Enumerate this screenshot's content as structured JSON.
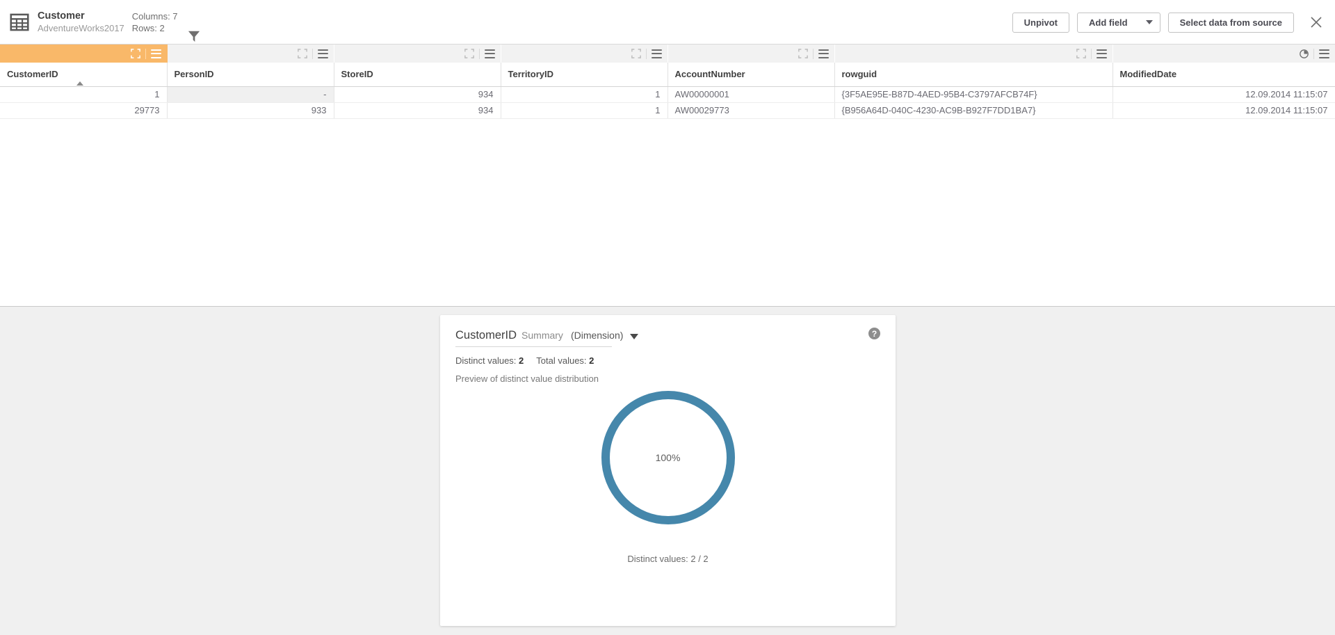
{
  "header": {
    "table_icon": "table-icon",
    "table_name": "Customer",
    "source_name": "AdventureWorks2017",
    "columns_label": "Columns: 7",
    "rows_label": "Rows: 2",
    "filter_icon": "filter-icon",
    "buttons": {
      "unpivot": "Unpivot",
      "add_field": "Add field",
      "select_data": "Select data from source",
      "close_icon": "close-icon"
    }
  },
  "table": {
    "columns": [
      {
        "name": "CustomerID",
        "align": "num",
        "selected": true,
        "sorted": "asc",
        "tool_icon": "expand-icon"
      },
      {
        "name": "PersonID",
        "align": "num",
        "selected": false,
        "sorted": null,
        "tool_icon": "expand-icon"
      },
      {
        "name": "StoreID",
        "align": "num",
        "selected": false,
        "sorted": null,
        "tool_icon": "expand-icon"
      },
      {
        "name": "TerritoryID",
        "align": "num",
        "selected": false,
        "sorted": null,
        "tool_icon": "expand-icon"
      },
      {
        "name": "AccountNumber",
        "align": "txt",
        "selected": false,
        "sorted": null,
        "tool_icon": "expand-icon"
      },
      {
        "name": "rowguid",
        "align": "txt",
        "selected": false,
        "sorted": null,
        "tool_icon": "expand-icon"
      },
      {
        "name": "ModifiedDate",
        "align": "num",
        "selected": false,
        "sorted": null,
        "tool_icon": "clock-icon"
      }
    ],
    "rows": [
      {
        "cells": [
          "1",
          "-",
          "934",
          "1",
          "AW00000001",
          "{3F5AE95E-B87D-4AED-95B4-C3797AFCB74F}",
          "12.09.2014 11:15:07"
        ],
        "null_cell_index": 1
      },
      {
        "cells": [
          "29773",
          "933",
          "934",
          "1",
          "AW00029773",
          "{B956A64D-040C-4230-AC9B-B927F7DD1BA7}",
          "12.09.2014 11:15:07"
        ],
        "null_cell_index": -1
      }
    ]
  },
  "summary": {
    "field_name": "CustomerID",
    "subtitle": "Summary",
    "dimension": "(Dimension)",
    "dropdown_icon": "chevron-down-icon",
    "help_icon": "help-icon",
    "distinct_label": "Distinct values:",
    "distinct_value": "2",
    "total_label": "Total values:",
    "total_value": "2",
    "preview_label": "Preview of distinct value distribution",
    "donut_center_label": "100%",
    "donut_caption": "Distinct values: 2 / 2"
  },
  "colors": {
    "selected_header": "#f9b869",
    "donut": "#4587ab",
    "toolbar_bg": "#f2f2f2",
    "panel_bg": "#f0f0f0"
  },
  "chart_data": {
    "type": "pie",
    "title": "Preview of distinct value distribution",
    "categories": [
      "Distinct values"
    ],
    "values": [
      100
    ],
    "labels": [
      "100%"
    ],
    "total": 2,
    "distinct": 2,
    "caption": "Distinct values: 2 / 2",
    "donut": true,
    "legend": "none"
  }
}
